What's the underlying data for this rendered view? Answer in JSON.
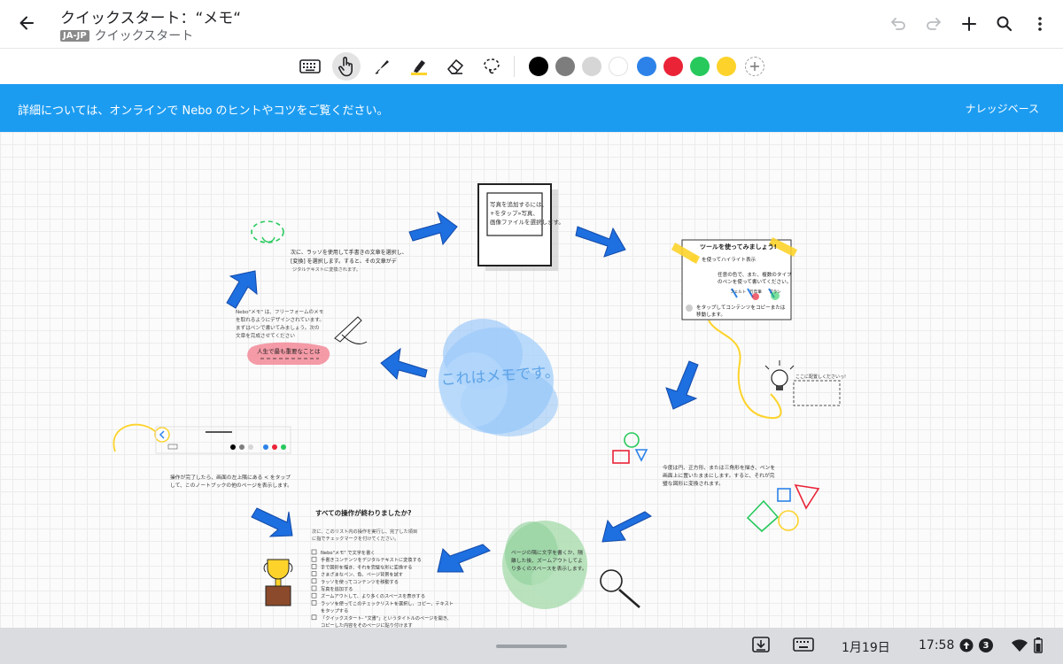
{
  "app_bar": {
    "title": "クイックスタート：“メモ“",
    "language_badge": "JA-JP",
    "breadcrumb": "クイックスタート"
  },
  "toolbar": {
    "tools": [
      "keyboard-icon",
      "touch-hand-icon",
      "pen-icon",
      "highlighter-icon",
      "eraser-icon",
      "lasso-icon"
    ],
    "active_tool": "touch-hand-icon",
    "colors": [
      "#000000",
      "#7d7d7d",
      "#d6d6d6",
      "#ffffff",
      "#2c82e8",
      "#ea2337",
      "#27c95c",
      "#fdd32b"
    ]
  },
  "banner": {
    "text": "詳細については、オンラインで Nebo のヒントやコツをご覧ください。",
    "link": "ナレッジベース"
  },
  "canvas": {
    "center_text": "これはメモです。",
    "photo_note": [
      "写真を追加するには、",
      "+をタップ»写真、",
      "画像ファイルを選択します。"
    ],
    "tools_card_title": "ツールを使ってみましょう!",
    "tools_card_highlight": "を使ってハイライト表示",
    "tools_card_pens": [
      "任意の色で、また、複数のタイプ",
      "のペンを使って書いてください。"
    ],
    "pen_labels": [
      "フェルト",
      "万年筆",
      "ブラシ"
    ],
    "tools_card_copy": [
      "をタップしてコンテンツをコピーまたは",
      "移動します。"
    ],
    "bulb_note": "ここに配置しくださいっ!",
    "shapes_text": [
      "今度は円、正方形、または三角形を描き、ペンを",
      "画面上に置いたままにします。すると、それが完",
      "璧な図形に変換されます。"
    ],
    "zoom_text": [
      "ページの隅に文字を書くか、隔",
      "離した後、ズームアウトしてよ",
      "り多くのスペースを表示します。"
    ],
    "checklist_title": "すべての操作が終わりましたか?",
    "checklist_intro": [
      "次に、このリスト内の操作を実行し、完了した項目",
      "に指でチェックマークを付けてください。"
    ],
    "checklist_items": [
      "Nebo\"メモ\" で文字を書く",
      "手書きコンテンツをデジタルテキストに変換する",
      "手で図形を描き、それを完璧な形に変換する",
      "さまざまなペン、色、ページ背景を試す",
      "ラッソを使ってコンテンツを移動する",
      "写真を追加する",
      "ズームアウトして、より多くのスペースを表示する",
      "ラッソを使ってこのチェックリストを選択し、コピー、テキスト",
      "をタップする",
      "「クイックスタート- \"文書\"」というタイトルのページを開き、",
      "コピーした内容をそのページに貼り付けます"
    ],
    "nav_note": [
      "操作が完了したら、画面の左上隅にある < をタップ",
      "して、このノートブックの他のページを表示します。"
    ],
    "intro_text": [
      "Nebo\"メモ\" は、フリーフォームのメモ",
      "を取れるようにデザインされています。",
      "まずはペンで書いてみましょう。次の",
      "文章を完成させてください"
    ],
    "pink_box": "人生で最も重要なことは",
    "lasso_text": [
      "次に、ラッソを使用して手書きの文章を選択し、",
      "[変換] を選択します。すると、その文章がデ",
      "ジタルテキストに変換されます。"
    ]
  },
  "shelf": {
    "date": "1月19日",
    "time": "17:58",
    "notification_count": "3"
  }
}
